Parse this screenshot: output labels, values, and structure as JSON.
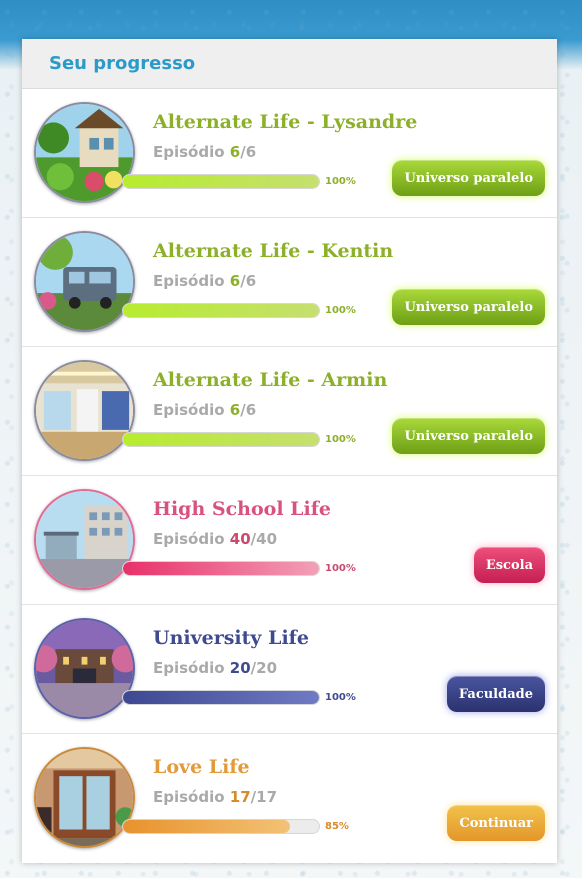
{
  "panel": {
    "title": "Seu progresso"
  },
  "stories": [
    {
      "title": "Alternate Life - Lysandre",
      "episode_prefix": "Episódio",
      "current": "6",
      "total": "/6",
      "progress": 100,
      "percent_label": "100%",
      "button_label": "Universo paralelo",
      "theme": {
        "title": "#8cb02a",
        "accent": "#8cb02a",
        "bar_from": "#b7ec2e",
        "bar_to": "#c6df70",
        "btn_from": "#a9d93a",
        "btn_to": "#6e9f15",
        "glow": "#d9ff6a"
      },
      "thumbnail": "cottage-garden-image"
    },
    {
      "title": "Alternate Life - Kentin",
      "episode_prefix": "Episódio",
      "current": "6",
      "total": "/6",
      "progress": 100,
      "percent_label": "100%",
      "button_label": "Universo paralelo",
      "theme": {
        "title": "#8cb02a",
        "accent": "#8cb02a",
        "bar_from": "#b7ec2e",
        "bar_to": "#c6df70",
        "btn_from": "#a9d93a",
        "btn_to": "#6e9f15",
        "glow": "#d9ff6a"
      },
      "thumbnail": "camper-van-image"
    },
    {
      "title": "Alternate Life - Armin",
      "episode_prefix": "Episódio",
      "current": "6",
      "total": "/6",
      "progress": 100,
      "percent_label": "100%",
      "button_label": "Universo paralelo",
      "theme": {
        "title": "#8cb02a",
        "accent": "#8cb02a",
        "bar_from": "#b7ec2e",
        "bar_to": "#c6df70",
        "btn_from": "#a9d93a",
        "btn_to": "#6e9f15",
        "glow": "#d9ff6a"
      },
      "thumbnail": "mall-interior-image"
    },
    {
      "title": "High School Life",
      "episode_prefix": "Episódio",
      "current": "40",
      "total": "/40",
      "progress": 100,
      "percent_label": "100%",
      "button_label": "Escola",
      "theme": {
        "title": "#d9527f",
        "accent": "#c84a6f",
        "bar_from": "#e8306a",
        "bar_to": "#f2a0b8",
        "btn_from": "#ee4f7c",
        "btn_to": "#c41f52",
        "glow": "#ffb0c8"
      },
      "thumbnail": "school-building-image"
    },
    {
      "title": "University Life",
      "episode_prefix": "Episódio",
      "current": "20",
      "total": "/20",
      "progress": 100,
      "percent_label": "100%",
      "button_label": "Faculdade",
      "theme": {
        "title": "#3f4a8f",
        "accent": "#3f4a8f",
        "bar_from": "#3d4890",
        "bar_to": "#6f7bc4",
        "btn_from": "#4a55a0",
        "btn_to": "#2b326e",
        "glow": "#9aa4e6"
      },
      "thumbnail": "campus-gate-image"
    },
    {
      "title": "Love Life",
      "episode_prefix": "Episódio",
      "current": "17",
      "total": "/17",
      "progress": 85,
      "percent_label": "85%",
      "button_label": "Continuar",
      "theme": {
        "title": "#e29a3a",
        "accent": "#d88a2a",
        "bar_from": "#e8922c",
        "bar_to": "#f2c275",
        "btn_from": "#f2c24a",
        "btn_to": "#e3962a",
        "glow": "#ffe2a0"
      },
      "thumbnail": "cafe-storefront-image"
    }
  ]
}
